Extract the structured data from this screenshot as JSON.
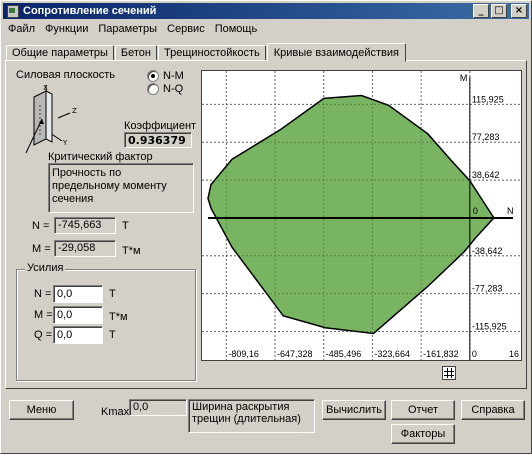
{
  "window": {
    "title": "Сопротивление сечений"
  },
  "menu": [
    "Файл",
    "Функции",
    "Параметры",
    "Сервис",
    "Помощь"
  ],
  "tabs": [
    "Общие параметры",
    "Бетон",
    "Трещиностойкость",
    "Кривые взаимодействия"
  ],
  "left": {
    "force_plane_label": "Силовая плоскость",
    "radio1": "N-M",
    "radio2": "N-Q",
    "coef_label": "Коэффициент",
    "coef_value": "0.936379",
    "critical_label": "Критический фактор",
    "critical_text": "Прочность по предельному моменту сечения",
    "n_label": "N =",
    "n_value": "-745,663",
    "n_unit": "T",
    "m_label": "M =",
    "m_value": "-29,058",
    "m_unit": "T*м",
    "efforts_title": "Усилия",
    "ef_n_label": "N =",
    "ef_n_value": "0,0",
    "ef_n_unit": "T",
    "ef_m_label": "M =",
    "ef_m_value": "0,0",
    "ef_m_unit": "T*м",
    "ef_q_label": "Q =",
    "ef_q_value": "0,0",
    "ef_q_unit": "T"
  },
  "plot": {
    "m_axis": "M",
    "n_axis": "N",
    "origin": "0",
    "y_ticks": [
      "115,925",
      "77,283",
      "38,642",
      "-38,642",
      "-77,283",
      "-115,925"
    ],
    "x_ticks": [
      "-809,16",
      "-647,328",
      "-485,496",
      "-323,664",
      "-161,832",
      "0",
      "16"
    ]
  },
  "chart_data": {
    "type": "area",
    "title": "",
    "xlabel": "N",
    "ylabel": "M",
    "xlim": [
      -890,
      170
    ],
    "ylim": [
      -145,
      150
    ],
    "x": [
      -630,
      -485,
      -360,
      -270,
      -140,
      -60,
      0,
      80,
      20,
      -20,
      -140,
      -320,
      -480,
      -620,
      -790,
      -860,
      -870,
      -860,
      -790
    ],
    "y": [
      90,
      122,
      125,
      115,
      86,
      58,
      38,
      0,
      -20,
      -35,
      -70,
      -118,
      -112,
      -100,
      -30,
      10,
      20,
      34,
      60
    ],
    "grid": true
  },
  "bottom": {
    "menu_btn": "Меню",
    "kmax_label": "Kmax=",
    "kmax_value": "0,0",
    "crack_text": "Ширина раскрытия трещин (длительная)",
    "calc_btn": "Вычислить",
    "report_btn": "Отчет",
    "help_btn": "Справка",
    "factors_btn": "Факторы"
  },
  "colors": {
    "fill": "#6cae55",
    "title_start": "#0a246a",
    "title_end": "#3a6ea5"
  }
}
